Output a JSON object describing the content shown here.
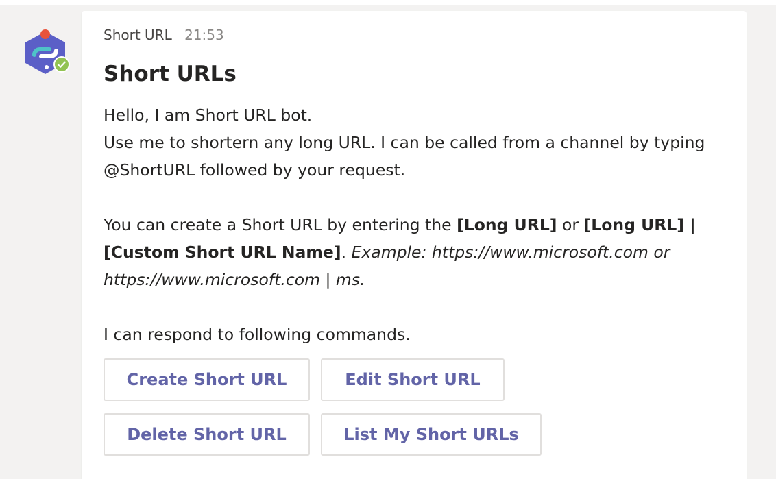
{
  "message": {
    "sender": "Short URL",
    "timestamp": "21:53"
  },
  "card": {
    "title": "Short URLs",
    "paragraph1_line1": "Hello, I am Short URL bot.",
    "paragraph1_line2": "Use me to shortern any long URL. I can be called from a channel by typing @ShortURL followed by your request.",
    "paragraph2": {
      "intro": "You can create a Short URL by entering the ",
      "bold1": "[Long URL]",
      "or": " or ",
      "bold2": "[Long URL] | [Custom Short URL Name]",
      "period": ". ",
      "example": "Example: https://www.microsoft.com or https://www.microsoft.com | ms."
    },
    "paragraph3": "I can respond to following commands."
  },
  "actions": {
    "create": "Create Short URL",
    "edit": "Edit Short URL",
    "delete": "Delete Short URL",
    "list": "List My Short URLs"
  },
  "icons": {
    "avatar": "chain-link-hexagon-icon",
    "status": "checkmark-status-icon"
  },
  "colors": {
    "accent": "#6264a7",
    "avatar_hex": "#5b5fc7",
    "link_teal": "#4fc3c8",
    "notification_dot": "#e9533b",
    "status_green": "#92c353"
  }
}
